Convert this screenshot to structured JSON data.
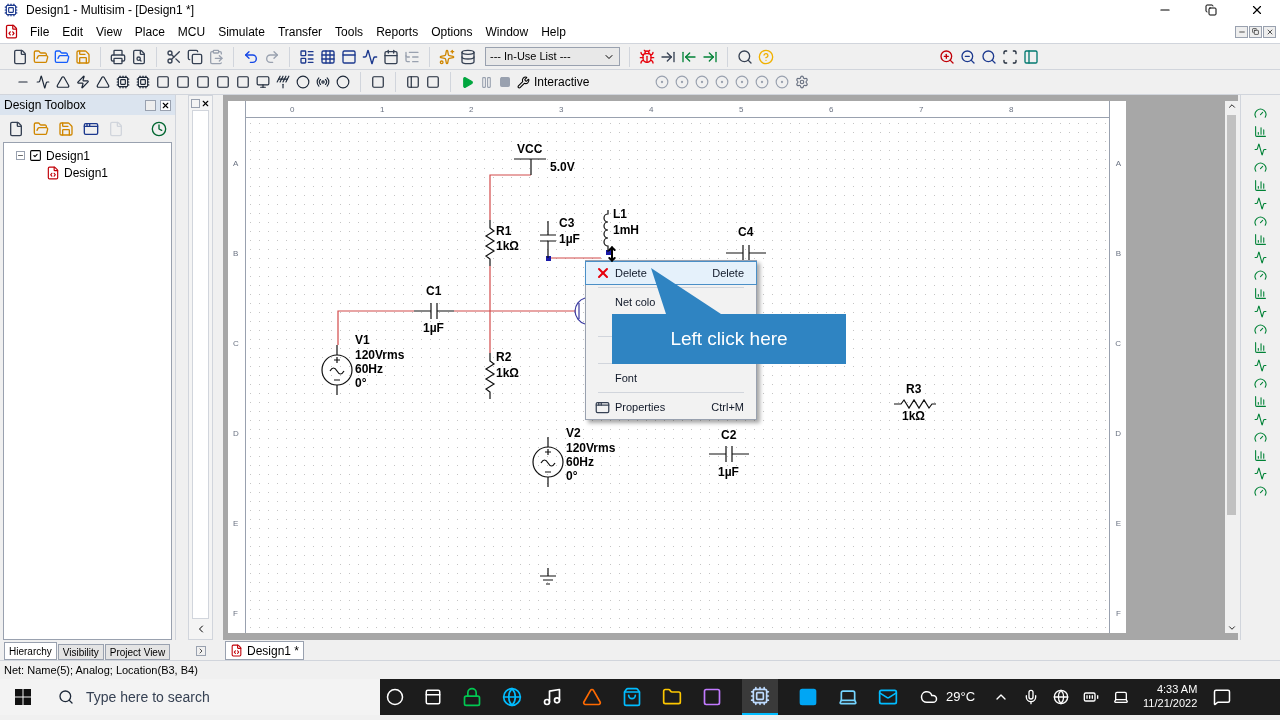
{
  "window": {
    "title": "Design1 - Multisim - [Design1 *]"
  },
  "menu": [
    "File",
    "Edit",
    "View",
    "Place",
    "MCU",
    "Simulate",
    "Transfer",
    "Tools",
    "Reports",
    "Options",
    "Window",
    "Help"
  ],
  "toolbar": {
    "in_use_list": "--- In-Use List ---",
    "interactive": "Interactive"
  },
  "design_toolbox": {
    "title": "Design Toolbox",
    "tree": [
      {
        "label": "Design1",
        "expanded": true,
        "children": [
          {
            "label": "Design1"
          }
        ]
      }
    ]
  },
  "panel_tabs": [
    {
      "label": "Hierarchy",
      "selected": true
    },
    {
      "label": "Visibility",
      "selected": false
    },
    {
      "label": "Project View",
      "selected": false
    }
  ],
  "sheet_tabs": [
    {
      "label": "Design1 *",
      "selected": true
    }
  ],
  "rulers": {
    "columns": [
      "0",
      "1",
      "2",
      "3",
      "4",
      "5",
      "6",
      "7",
      "8"
    ],
    "rows": [
      "A",
      "B",
      "C",
      "D",
      "E",
      "F"
    ],
    "rows_right": [
      "A",
      "B",
      "C",
      "D",
      "E",
      "F"
    ]
  },
  "schematic": {
    "components": [
      {
        "kind": "vcc",
        "labels": [
          "VCC",
          "5.0V"
        ]
      },
      {
        "kind": "capacitor_v",
        "labels": [
          "C3",
          "1µF"
        ]
      },
      {
        "kind": "inductor",
        "labels": [
          "L1",
          "1mH"
        ]
      },
      {
        "kind": "resistor_v",
        "labels": [
          "R1",
          "1kΩ"
        ]
      },
      {
        "kind": "capacitor_h",
        "labels": [
          "C4"
        ]
      },
      {
        "kind": "capacitor_h",
        "labels": [
          "C1",
          "1µF"
        ]
      },
      {
        "kind": "ac_source",
        "labels": [
          "V1",
          "120Vrms",
          "60Hz",
          "0°"
        ]
      },
      {
        "kind": "resistor_v",
        "labels": [
          "R2",
          "1kΩ"
        ]
      },
      {
        "kind": "resistor_h",
        "labels": [
          "R3",
          "1kΩ"
        ]
      },
      {
        "kind": "ac_source",
        "labels": [
          "V2",
          "120Vrms",
          "60Hz",
          "0°"
        ]
      },
      {
        "kind": "capacitor_h",
        "labels": [
          "C2",
          "1µF"
        ]
      },
      {
        "kind": "ground"
      }
    ]
  },
  "context_menu": {
    "items": [
      {
        "kind": "item",
        "label": "Delete",
        "shortcut": "Delete",
        "highlighted": true
      },
      {
        "kind": "separator"
      },
      {
        "kind": "item",
        "label": "Net colo",
        "highlighted": false
      },
      {
        "kind": "covered"
      },
      {
        "kind": "separator"
      },
      {
        "kind": "covered"
      },
      {
        "kind": "separator"
      },
      {
        "kind": "item",
        "label": "Font",
        "highlighted": false
      },
      {
        "kind": "separator"
      },
      {
        "kind": "item",
        "label": "Properties",
        "shortcut": "Ctrl+M",
        "highlighted": false
      }
    ]
  },
  "callout": {
    "text": "Left click here"
  },
  "status_bar": {
    "text": "Net: Name(5); Analog; Location(B3, B4)"
  },
  "taskbar": {
    "search_placeholder": "Type here to search",
    "weather": "29°C",
    "time": "4:33 AM",
    "date": "11/21/2022"
  }
}
